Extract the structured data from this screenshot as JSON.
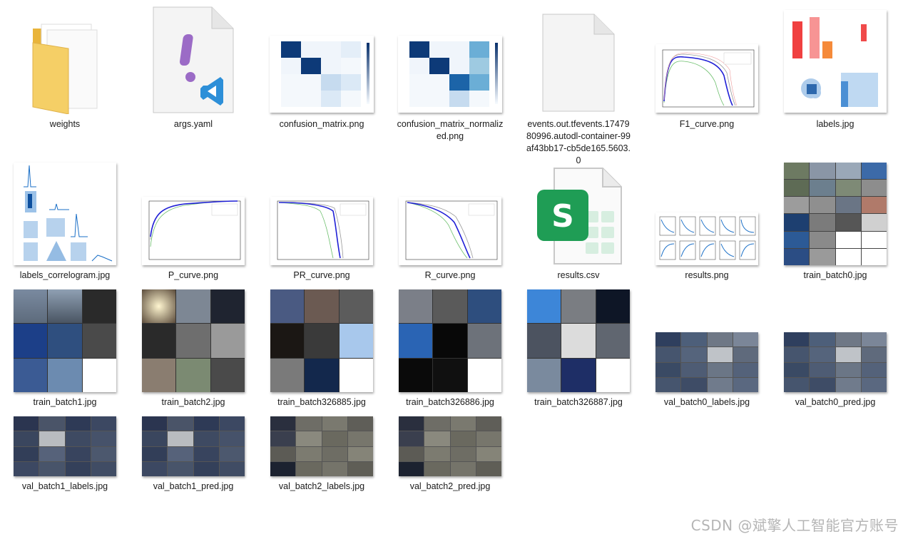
{
  "files": [
    {
      "name": "weights",
      "icon": "folder-icon"
    },
    {
      "name": "args.yaml",
      "icon": "yaml-file-icon"
    },
    {
      "name": "confusion_matrix.png",
      "icon": "image-thumbnail"
    },
    {
      "name": "confusion_matrix_normalized.png",
      "icon": "image-thumbnail"
    },
    {
      "name": "events.out.tfevents.1747980996.autodl-container-99af43bb17-cb5de165.5603.0",
      "icon": "blank-file-icon"
    },
    {
      "name": "F1_curve.png",
      "icon": "image-thumbnail"
    },
    {
      "name": "labels.jpg",
      "icon": "image-thumbnail"
    },
    {
      "name": "labels_correlogram.jpg",
      "icon": "image-thumbnail"
    },
    {
      "name": "P_curve.png",
      "icon": "image-thumbnail"
    },
    {
      "name": "PR_curve.png",
      "icon": "image-thumbnail"
    },
    {
      "name": "R_curve.png",
      "icon": "image-thumbnail"
    },
    {
      "name": "results.csv",
      "icon": "spreadsheet-file-icon"
    },
    {
      "name": "results.png",
      "icon": "image-thumbnail"
    },
    {
      "name": "train_batch0.jpg",
      "icon": "image-thumbnail"
    },
    {
      "name": "train_batch1.jpg",
      "icon": "image-thumbnail"
    },
    {
      "name": "train_batch2.jpg",
      "icon": "image-thumbnail"
    },
    {
      "name": "train_batch326885.jpg",
      "icon": "image-thumbnail"
    },
    {
      "name": "train_batch326886.jpg",
      "icon": "image-thumbnail"
    },
    {
      "name": "train_batch326887.jpg",
      "icon": "image-thumbnail"
    },
    {
      "name": "val_batch0_labels.jpg",
      "icon": "image-thumbnail"
    },
    {
      "name": "val_batch0_pred.jpg",
      "icon": "image-thumbnail"
    },
    {
      "name": "val_batch1_labels.jpg",
      "icon": "image-thumbnail"
    },
    {
      "name": "val_batch1_pred.jpg",
      "icon": "image-thumbnail"
    },
    {
      "name": "val_batch2_labels.jpg",
      "icon": "image-thumbnail"
    },
    {
      "name": "val_batch2_pred.jpg",
      "icon": "image-thumbnail"
    }
  ],
  "watermark": "CSDN @斌擎人工智能官方账号",
  "colors": {
    "folder": "#f3c552",
    "vscode_blue": "#2d8fd8",
    "yaml_purple": "#9b6bc6",
    "sheet_green": "#1f9d55",
    "matrix_blue": "#08306b"
  }
}
